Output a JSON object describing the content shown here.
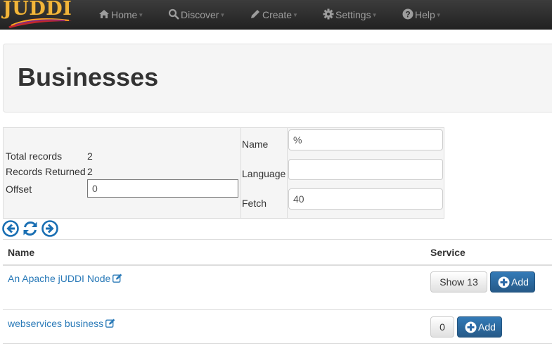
{
  "navbar": {
    "brand": "JUDDI",
    "items": [
      {
        "label": "Home",
        "icon": "home-icon"
      },
      {
        "label": "Discover",
        "icon": "search-icon"
      },
      {
        "label": "Create",
        "icon": "pencil-icon"
      },
      {
        "label": "Settings",
        "icon": "gear-icon"
      },
      {
        "label": "Help",
        "icon": "question-icon"
      }
    ]
  },
  "page": {
    "title": "Businesses"
  },
  "search": {
    "total_records_label": "Total records",
    "total_records_value": "2",
    "records_returned_label": "Records Returned",
    "records_returned_value": "2",
    "offset_label": "Offset",
    "offset_value": "0",
    "name_label": "Name",
    "name_value": "%",
    "language_label": "Language",
    "language_value": "",
    "fetch_label": "Fetch",
    "fetch_value": "40"
  },
  "pager": {
    "icons": [
      "previous-icon",
      "refresh-icon",
      "next-icon"
    ]
  },
  "table": {
    "headers": {
      "name": "Name",
      "service": "Service"
    },
    "rows": [
      {
        "name": "An Apache jUDDI Node",
        "service_count_label": "Show 13",
        "add_label": "Add"
      },
      {
        "name": "webservices business",
        "service_count_label": "0",
        "add_label": "Add"
      }
    ]
  },
  "colors": {
    "navbar": "#222222",
    "link": "#2a7ab8",
    "primary": "#337ab7",
    "brand": "#f2b53a"
  }
}
